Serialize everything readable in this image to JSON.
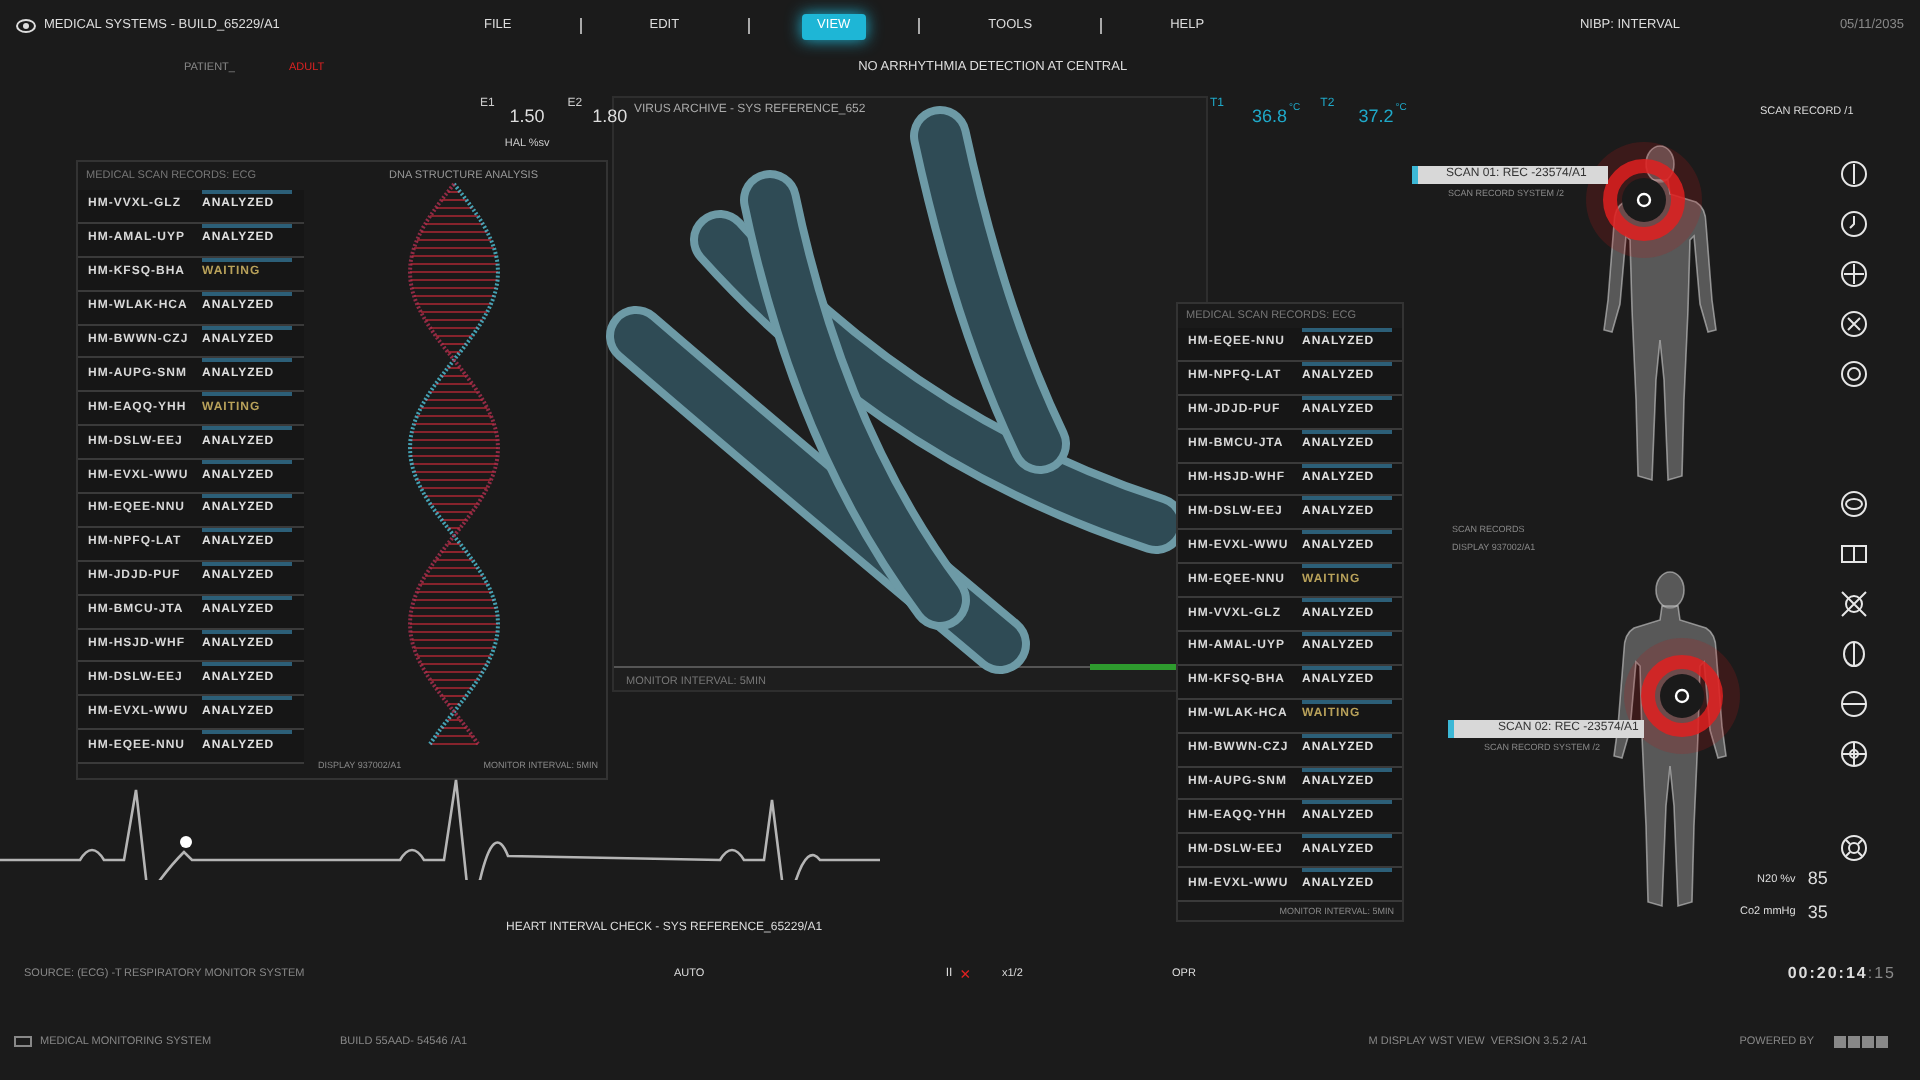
{
  "header": {
    "title": "MEDICAL SYSTEMS - BUILD_65229/A1",
    "menu": [
      {
        "label": "FILE",
        "selected": false
      },
      {
        "label": "EDIT",
        "selected": false
      },
      {
        "label": "VIEW",
        "selected": true
      },
      {
        "label": "TOOLS",
        "selected": false
      },
      {
        "label": "HELP",
        "selected": false
      }
    ],
    "nibp": "NIBP: INTERVAL",
    "date": "05/11/2035"
  },
  "patient": {
    "label": "PATIENT_",
    "value": "ADULT"
  },
  "alert": "NO ARRHYTHMIA DETECTION AT CENTRAL",
  "readings": {
    "e1_label": "E1",
    "e1_value": "1.50",
    "e2_label": "E2",
    "e2_value": "1.80",
    "hal_label": "HAL %sv",
    "t1_label": "T1",
    "t1_value": "36.8",
    "t1_unit": "°C",
    "t2_label": "T2",
    "t2_value": "37.2",
    "t2_unit": "°C"
  },
  "virus_panel": {
    "title": "VIRUS ARCHIVE - SYS REFERENCE_652",
    "footer": "MONITOR INTERVAL: 5MIN"
  },
  "left_panel": {
    "title": "MEDICAL SCAN RECORDS: ECG",
    "subtitle": "DNA STRUCTURE ANALYSIS",
    "footer_1": "DISPLAY 937002/A1",
    "footer_2": "MONITOR INTERVAL: 5MIN",
    "rows": [
      {
        "id": "HM-VVXL-GLZ",
        "status": "ANALYZED",
        "kind": "analyzed"
      },
      {
        "id": "HM-AMAL-UYP",
        "status": "ANALYZED",
        "kind": "analyzed"
      },
      {
        "id": "HM-KFSQ-BHA",
        "status": "WAITING",
        "kind": "waiting"
      },
      {
        "id": "HM-WLAK-HCA",
        "status": "ANALYZED",
        "kind": "analyzed"
      },
      {
        "id": "HM-BWWN-CZJ",
        "status": "ANALYZED",
        "kind": "analyzed"
      },
      {
        "id": "HM-AUPG-SNM",
        "status": "ANALYZED",
        "kind": "analyzed"
      },
      {
        "id": "HM-EAQQ-YHH",
        "status": "WAITING",
        "kind": "waiting"
      },
      {
        "id": "HM-DSLW-EEJ",
        "status": "ANALYZED",
        "kind": "analyzed"
      },
      {
        "id": "HM-EVXL-WWU",
        "status": "ANALYZED",
        "kind": "analyzed"
      },
      {
        "id": "HM-EQEE-NNU",
        "status": "ANALYZED",
        "kind": "analyzed"
      },
      {
        "id": "HM-NPFQ-LAT",
        "status": "ANALYZED",
        "kind": "analyzed"
      },
      {
        "id": "HM-JDJD-PUF",
        "status": "ANALYZED",
        "kind": "analyzed"
      },
      {
        "id": "HM-BMCU-JTA",
        "status": "ANALYZED",
        "kind": "analyzed"
      },
      {
        "id": "HM-HSJD-WHF",
        "status": "ANALYZED",
        "kind": "analyzed"
      },
      {
        "id": "HM-DSLW-EEJ",
        "status": "ANALYZED",
        "kind": "analyzed"
      },
      {
        "id": "HM-EVXL-WWU",
        "status": "ANALYZED",
        "kind": "analyzed"
      },
      {
        "id": "HM-EQEE-NNU",
        "status": "ANALYZED",
        "kind": "analyzed"
      }
    ]
  },
  "right_panel": {
    "title": "MEDICAL SCAN RECORDS: ECG",
    "footer": "MONITOR INTERVAL: 5MIN",
    "rows": [
      {
        "id": "HM-EQEE-NNU",
        "status": "ANALYZED",
        "kind": "analyzed"
      },
      {
        "id": "HM-NPFQ-LAT",
        "status": "ANALYZED",
        "kind": "analyzed"
      },
      {
        "id": "HM-JDJD-PUF",
        "status": "ANALYZED",
        "kind": "analyzed"
      },
      {
        "id": "HM-BMCU-JTA",
        "status": "ANALYZED",
        "kind": "analyzed"
      },
      {
        "id": "HM-HSJD-WHF",
        "status": "ANALYZED",
        "kind": "analyzed"
      },
      {
        "id": "HM-DSLW-EEJ",
        "status": "ANALYZED",
        "kind": "analyzed"
      },
      {
        "id": "HM-EVXL-WWU",
        "status": "ANALYZED",
        "kind": "analyzed"
      },
      {
        "id": "HM-EQEE-NNU",
        "status": "WAITING",
        "kind": "waiting"
      },
      {
        "id": "HM-VVXL-GLZ",
        "status": "ANALYZED",
        "kind": "analyzed"
      },
      {
        "id": "HM-AMAL-UYP",
        "status": "ANALYZED",
        "kind": "analyzed"
      },
      {
        "id": "HM-KFSQ-BHA",
        "status": "ANALYZED",
        "kind": "analyzed"
      },
      {
        "id": "HM-WLAK-HCA",
        "status": "WAITING",
        "kind": "waiting"
      },
      {
        "id": "HM-BWWN-CZJ",
        "status": "ANALYZED",
        "kind": "analyzed"
      },
      {
        "id": "HM-AUPG-SNM",
        "status": "ANALYZED",
        "kind": "analyzed"
      },
      {
        "id": "HM-EAQQ-YHH",
        "status": "ANALYZED",
        "kind": "analyzed"
      },
      {
        "id": "HM-DSLW-EEJ",
        "status": "ANALYZED",
        "kind": "analyzed"
      },
      {
        "id": "HM-EVXL-WWU",
        "status": "ANALYZED",
        "kind": "analyzed"
      }
    ]
  },
  "body_scan": {
    "record": "SCAN RECORD /1",
    "scan_1": "SCAN 01: REC -23574/A1",
    "scan_1_sub": "SCAN RECORD SYSTEM /2",
    "records_label": "SCAN RECORDS",
    "records_display": "DISPLAY 937002/A1",
    "scan_2": "SCAN 02: REC -23574/A1",
    "scan_2_sub": "SCAN RECORD SYSTEM /2"
  },
  "gases": [
    {
      "label": "N20 %v",
      "value": "85"
    },
    {
      "label": "Co2 mmHg",
      "value": "35"
    }
  ],
  "ecg_caption": "HEART INTERVAL CHECK - SYS REFERENCE_65229/A1",
  "status_row": {
    "source": "SOURCE: (ECG) -T",
    "system": "RESPIRATORY MONITOR SYSTEM",
    "mode": "AUTO",
    "pause": "II",
    "stop": "×",
    "speed": "x1/2",
    "opr": "OPR",
    "time": "00:20:14",
    "frames": ":15"
  },
  "footer": {
    "system": "MEDICAL MONITORING SYSTEM",
    "build": "BUILD 55AAD- 54546 /A1",
    "version": "M DISPLAY WST VIEW  VERSION 3.5.2 /A1",
    "powered": "POWERED BY"
  }
}
